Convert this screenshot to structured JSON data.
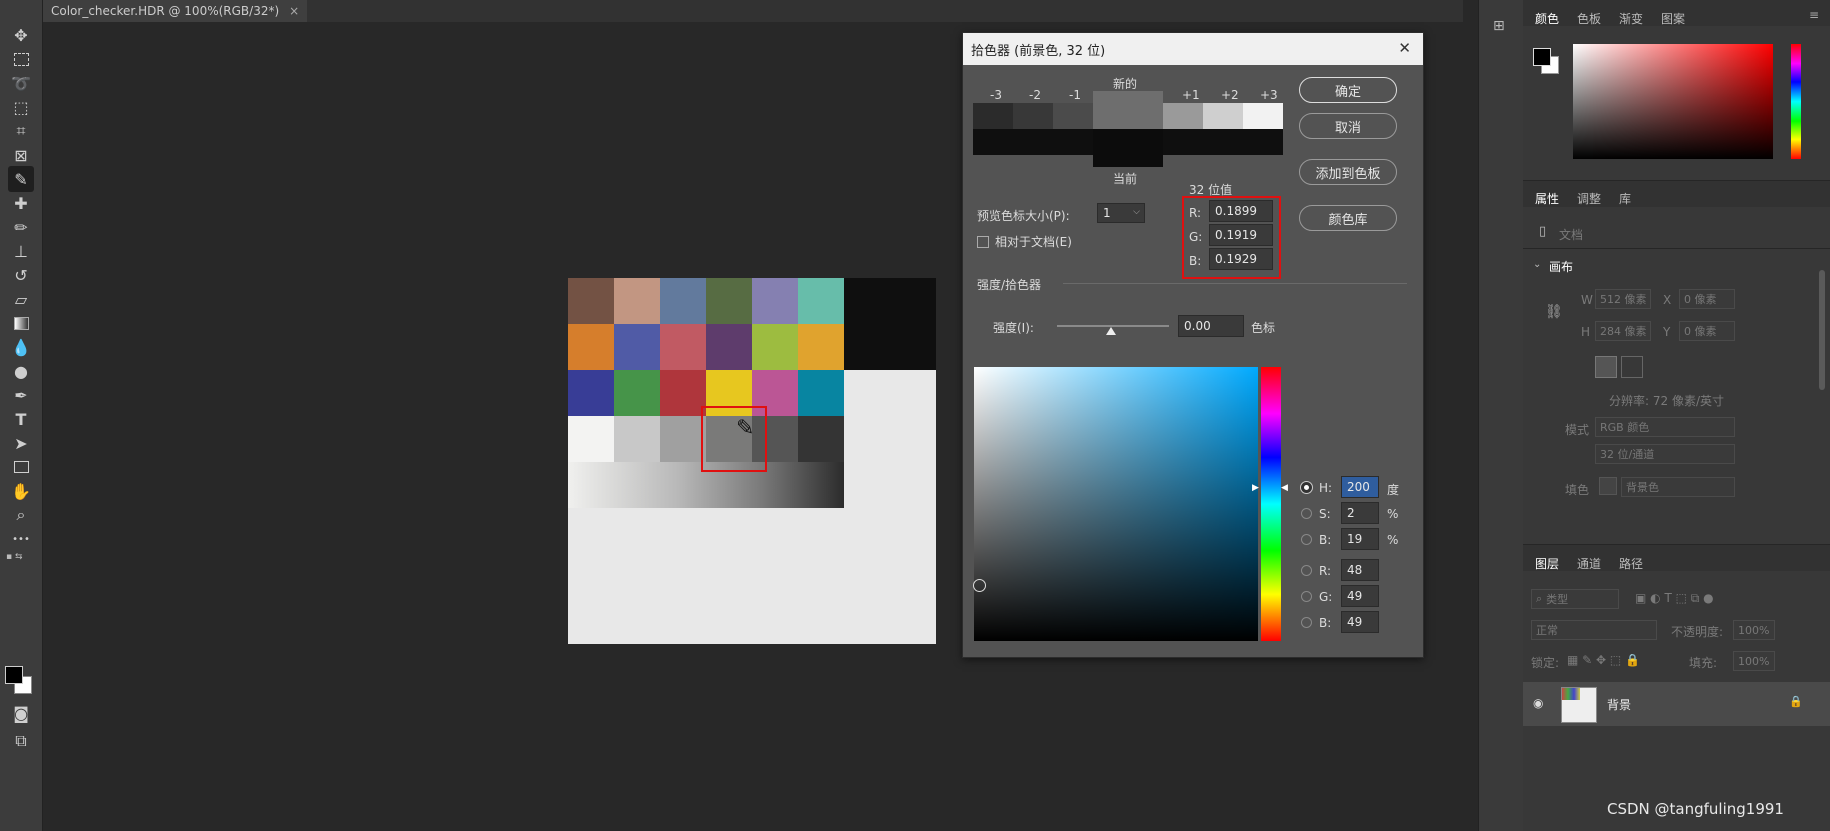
{
  "document": {
    "tab_title": "Color_checker.HDR @ 100%(RGB/32*)",
    "close_glyph": "×"
  },
  "toolbar": {
    "tools": [
      "move-icon",
      "marquee-icon",
      "lasso-icon",
      "object-select-icon",
      "crop-icon",
      "frame-icon",
      "eyedropper-icon",
      "healing-icon",
      "brush-icon",
      "stamp-icon",
      "history-brush-icon",
      "eraser-icon",
      "gradient-icon",
      "blur-icon",
      "dodge-icon",
      "pen-icon",
      "type-icon",
      "path-select-icon",
      "rectangle-icon",
      "hand-icon",
      "zoom-icon",
      "more-icon"
    ],
    "type_glyph": "T",
    "more_glyph": "•••"
  },
  "checker": {
    "rows": [
      [
        "#735244",
        "#c29682",
        "#627a9d",
        "#576c43",
        "#8580b1",
        "#67bdaa"
      ],
      [
        "#d67e2c",
        "#505ba6",
        "#c15a63",
        "#5e3c6c",
        "#9dbc40",
        "#e0a32e"
      ],
      [
        "#383d96",
        "#469449",
        "#af363c",
        "#e7c71f",
        "#bb5695",
        "#0885a1"
      ],
      [
        "#f3f3f2",
        "#c8c8c8",
        "#a0a0a0",
        "#7a7a79",
        "#555555",
        "#343434"
      ]
    ]
  },
  "picker": {
    "title": "拾色器 (前景色, 32 位)",
    "close_glyph": "✕",
    "stops_labels": [
      "-3",
      "-2",
      "-1",
      "+1",
      "+2",
      "+3"
    ],
    "new_label": "新的",
    "current_label": "当前",
    "buttons": {
      "ok": "确定",
      "cancel": "取消",
      "add_swatch": "添加到色板",
      "libraries": "颜色库"
    },
    "preview_size_label": "预览色标大小(P):",
    "preview_size_value": "1",
    "relative_label": "相对于文档(E)",
    "bit_label": "32 位值",
    "float": {
      "r_label": "R:",
      "r": "0.1899",
      "g_label": "G:",
      "g": "0.1919",
      "b_label": "B:",
      "b": "0.1929"
    },
    "intensity_section": "强度/拾色器",
    "intensity_label": "强度(I):",
    "intensity_value": "0.00",
    "intensity_unit": "色标",
    "hsb": {
      "h_label": "H:",
      "h": "200",
      "h_unit": "度",
      "s_label": "S:",
      "s": "2",
      "s_unit": "%",
      "b_label": "B:",
      "b": "19",
      "b_unit": "%"
    },
    "rgb": {
      "r_label": "R:",
      "r": "48",
      "g_label": "G:",
      "g": "49",
      "b_label": "B:",
      "b": "49"
    },
    "hue_deg": 200
  },
  "right_panel": {
    "color_tabs": [
      "颜色",
      "色板",
      "渐变",
      "图案"
    ],
    "prop_tabs": [
      "属性",
      "调整",
      "库"
    ],
    "doc_label": "文档",
    "canvas_header": "画布",
    "w_label": "W",
    "w_value": "512 像素",
    "x_label": "X",
    "x_value": "0 像素",
    "h_label": "H",
    "h_value": "284 像素",
    "y_label": "Y",
    "y_value": "0 像素",
    "resolution": "分辨率: 72 像素/英寸",
    "mode_label": "模式",
    "mode_value": "RGB 颜色",
    "depth_value": "32 位/通道",
    "fill_label": "填色",
    "fill_value": "背景色",
    "layer_tabs": [
      "图层",
      "通道",
      "路径"
    ],
    "kind_value": "类型",
    "blend_value": "正常",
    "opacity_label": "不透明度:",
    "opacity_value": "100%",
    "lock_label": "锁定:",
    "fill2_label": "填充:",
    "fill2_value": "100%",
    "layer_name": "背景"
  },
  "watermark": "CSDN @tangfuling1991",
  "colors": {
    "accent_red": "#e01010",
    "dialog_bg": "#535353"
  }
}
